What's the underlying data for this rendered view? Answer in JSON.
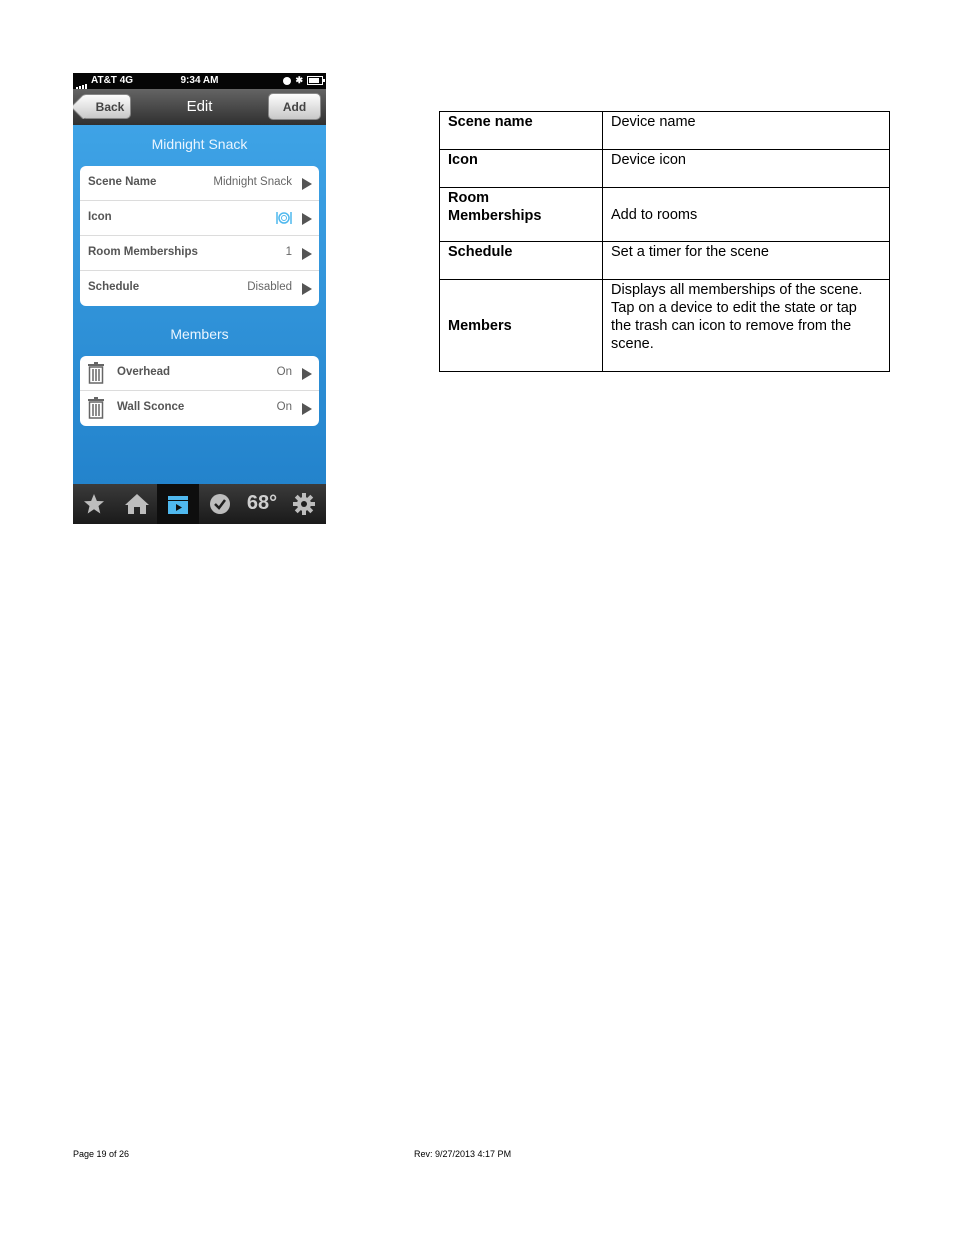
{
  "status_bar": {
    "carrier": "AT&T  4G",
    "time": "9:34 AM"
  },
  "nav": {
    "back_label": "Back",
    "title": "Edit",
    "add_label": "Add"
  },
  "scene": {
    "title": "Midnight Snack",
    "rows": [
      {
        "label": "Scene Name",
        "value": "Midnight Snack"
      },
      {
        "label": "Icon",
        "value": ""
      },
      {
        "label": "Room Memberships",
        "value": "1"
      },
      {
        "label": "Schedule",
        "value": "Disabled"
      }
    ]
  },
  "members": {
    "title": "Members",
    "rows": [
      {
        "label": "Overhead",
        "value": "On"
      },
      {
        "label": "Wall Sconce",
        "value": "On"
      }
    ]
  },
  "tab_bar": {
    "temperature": "68°"
  },
  "table": [
    {
      "key": "Scene name",
      "value": "Device name"
    },
    {
      "key": "Icon",
      "value": "Device icon"
    },
    {
      "key": "Room\nMemberships",
      "value": "Add to rooms"
    },
    {
      "key": "Schedule",
      "value": "Set a timer for the scene"
    },
    {
      "key": "Members",
      "value": "Displays all memberships of the scene. Tap on a device to edit the state or tap the trash can icon to remove from the scene."
    }
  ],
  "footer": {
    "page": "Page 19 of 26",
    "revision": "Rev: 9/27/2013 4:17 PM"
  },
  "colors": {
    "accent": "#2f8fd4",
    "icon_blue": "#4fb8ee"
  }
}
